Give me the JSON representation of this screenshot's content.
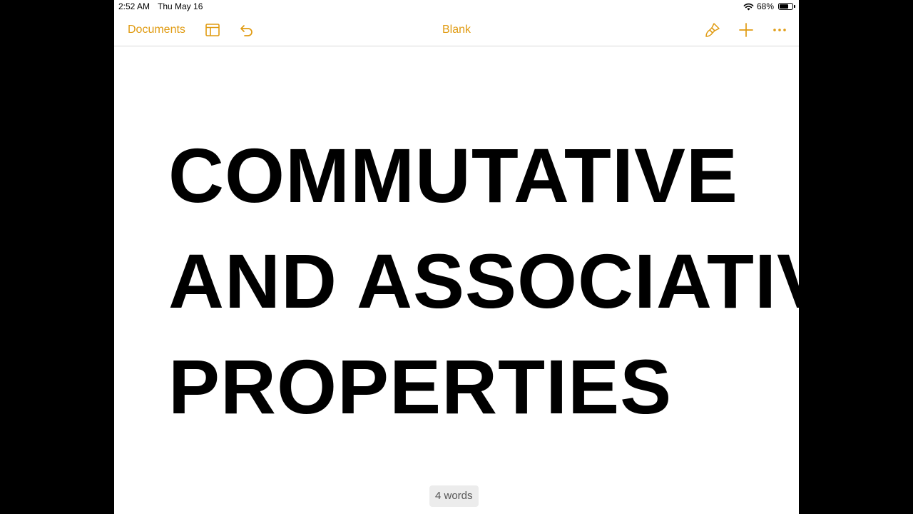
{
  "status_bar": {
    "time": "2:52 AM",
    "date": "Thu May 16",
    "battery_text": "68%",
    "battery_level": 0.68
  },
  "toolbar": {
    "documents_label": "Documents",
    "title": "Blank",
    "icons": [
      "sidebar-layout-icon",
      "undo-icon",
      "paintbrush-icon",
      "plus-icon",
      "more-icon"
    ],
    "accent_color": "#e09b12"
  },
  "document": {
    "lines": [
      "COMMUTATIVE",
      "AND ASSOCIATIVE",
      "PROPERTIES"
    ]
  },
  "footer": {
    "word_count": "4 words"
  }
}
